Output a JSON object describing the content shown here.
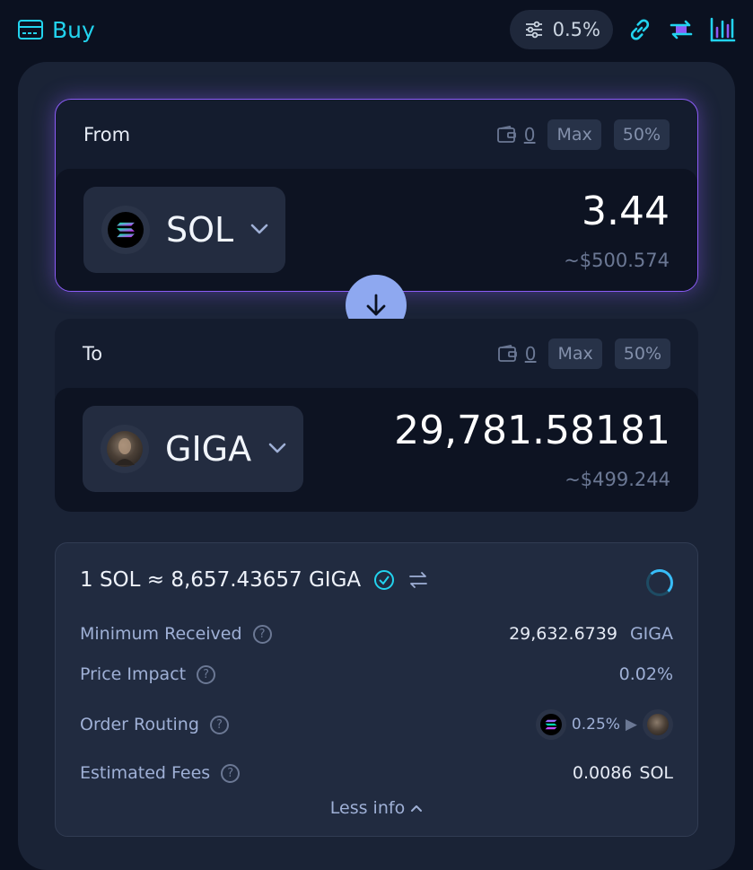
{
  "header": {
    "buy_label": "Buy",
    "slippage": "0.5%",
    "icons": [
      "card-icon",
      "sliders-icon",
      "link-icon",
      "swap-arrows-icon",
      "bar-chart-icon"
    ],
    "accent_color": "#22d3ee"
  },
  "from": {
    "title": "From",
    "balance": "0",
    "max_label": "Max",
    "half_label": "50%",
    "token": "SOL",
    "amount": "3.44",
    "usd_value": "~$500.574"
  },
  "to": {
    "title": "To",
    "balance": "0",
    "max_label": "Max",
    "half_label": "50%",
    "token": "GIGA",
    "amount": "29,781.58181",
    "usd_value": "~$499.244"
  },
  "info": {
    "rate": "1 SOL ≈ 8,657.43657 GIGA",
    "min_received_label": "Minimum Received",
    "min_received_value": "29,632.6739",
    "min_received_unit": "GIGA",
    "price_impact_label": "Price Impact",
    "price_impact_value": "0.02%",
    "routing_label": "Order Routing",
    "routing_pct": "0.25%",
    "routing_arrow": "▶",
    "fees_label": "Estimated Fees",
    "fees_value": "0.0086",
    "fees_unit": "SOL",
    "less_info_label": "Less info",
    "help_glyph": "?"
  },
  "colors": {
    "from_border": "#8b5cf6",
    "swap_button": "#8ea8f0",
    "verified": "#22d3ee"
  }
}
